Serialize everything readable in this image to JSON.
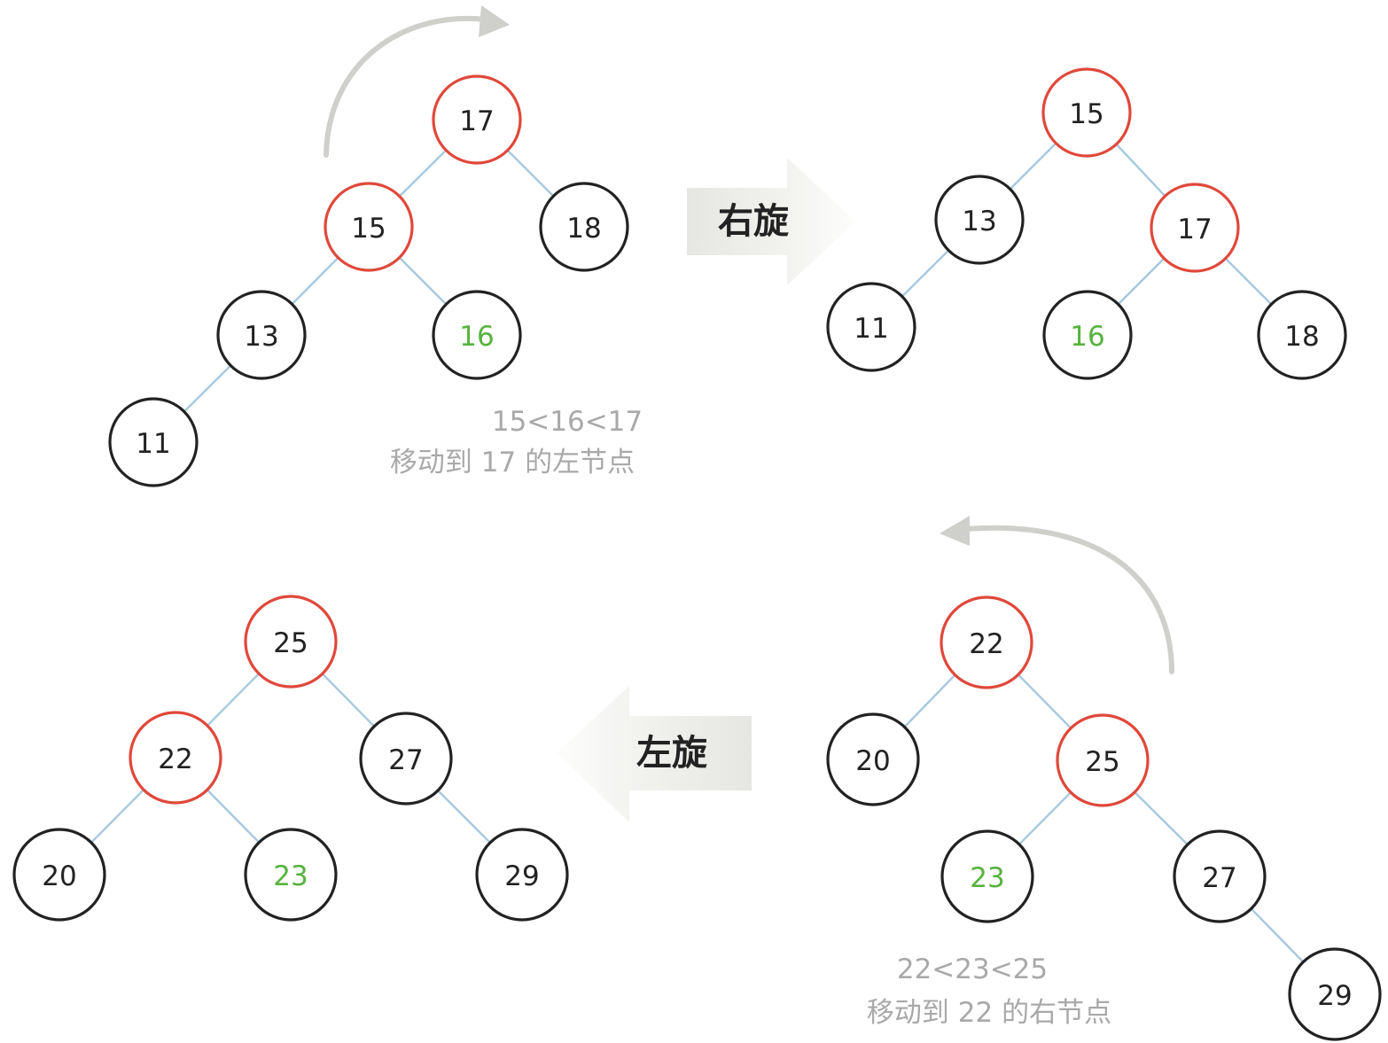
{
  "colors": {
    "red_node": "#e0483a",
    "black_node": "#222222",
    "inserted_value": "#56b33e",
    "edge": "#a7c9de",
    "note": "#a9a9a9",
    "rotation_arc": "#cfcfcb"
  },
  "panels": {
    "right_rotation_before": {
      "nodes": [
        {
          "value": "17",
          "color": "red"
        },
        {
          "value": "15",
          "color": "red"
        },
        {
          "value": "18",
          "color": "black"
        },
        {
          "value": "13",
          "color": "black"
        },
        {
          "value": "16",
          "color": "black",
          "highlight": true
        },
        {
          "value": "11",
          "color": "black"
        }
      ],
      "note_line1": "15<16<17",
      "note_line2": "移动到 17 的左节点",
      "rotation_arrow_icon": "curved-arrow-right-icon"
    },
    "right_rotation_after": {
      "nodes": [
        {
          "value": "15",
          "color": "red"
        },
        {
          "value": "13",
          "color": "black"
        },
        {
          "value": "17",
          "color": "red"
        },
        {
          "value": "11",
          "color": "black"
        },
        {
          "value": "16",
          "color": "black",
          "highlight": true
        },
        {
          "value": "18",
          "color": "black"
        }
      ]
    },
    "left_rotation_before": {
      "nodes": [
        {
          "value": "22",
          "color": "red"
        },
        {
          "value": "20",
          "color": "black"
        },
        {
          "value": "25",
          "color": "red"
        },
        {
          "value": "23",
          "color": "black",
          "highlight": true
        },
        {
          "value": "27",
          "color": "black"
        },
        {
          "value": "29",
          "color": "black"
        }
      ],
      "note_line1": "22<23<25",
      "note_line2": "移动到 22 的右节点",
      "rotation_arrow_icon": "curved-arrow-left-icon"
    },
    "left_rotation_after": {
      "nodes": [
        {
          "value": "25",
          "color": "red"
        },
        {
          "value": "22",
          "color": "red"
        },
        {
          "value": "27",
          "color": "black"
        },
        {
          "value": "20",
          "color": "black"
        },
        {
          "value": "23",
          "color": "black",
          "highlight": true
        },
        {
          "value": "29",
          "color": "black"
        }
      ]
    }
  },
  "arrows": {
    "right": {
      "label": "右旋",
      "icon": "arrow-right-icon"
    },
    "left": {
      "label": "左旋",
      "icon": "arrow-left-icon"
    }
  }
}
